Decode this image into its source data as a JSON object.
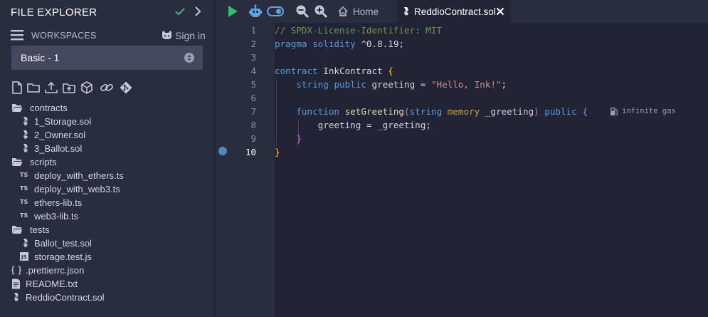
{
  "sidebar": {
    "title": "FILE EXPLORER",
    "workspaces_label": "WORKSPACES",
    "signin_label": "Sign in",
    "workspace_selected": "Basic - 1",
    "tree": [
      {
        "name": "folder-contracts",
        "label": "contracts",
        "kind": "folder"
      },
      {
        "name": "file-1-storage",
        "label": "1_Storage.sol",
        "kind": "sol"
      },
      {
        "name": "file-2-owner",
        "label": "2_Owner.sol",
        "kind": "sol"
      },
      {
        "name": "file-3-ballot",
        "label": "3_Ballot.sol",
        "kind": "sol"
      },
      {
        "name": "folder-scripts",
        "label": "scripts",
        "kind": "folder"
      },
      {
        "name": "file-deploy-ethers",
        "label": "deploy_with_ethers.ts",
        "kind": "ts"
      },
      {
        "name": "file-deploy-web3",
        "label": "deploy_with_web3.ts",
        "kind": "ts"
      },
      {
        "name": "file-ethers-lib",
        "label": "ethers-lib.ts",
        "kind": "ts"
      },
      {
        "name": "file-web3-lib",
        "label": "web3-lib.ts",
        "kind": "ts"
      },
      {
        "name": "folder-tests",
        "label": "tests",
        "kind": "folder"
      },
      {
        "name": "file-ballot-test",
        "label": "Ballot_test.sol",
        "kind": "sol"
      },
      {
        "name": "file-storage-test",
        "label": "storage.test.js",
        "kind": "js"
      },
      {
        "name": "file-prettierrc",
        "label": ".prettierrc.json",
        "kind": "json"
      },
      {
        "name": "file-readme",
        "label": "README.txt",
        "kind": "txt"
      },
      {
        "name": "file-reddio-contract",
        "label": "ReddioContract.sol",
        "kind": "sol"
      }
    ],
    "ts_badge": "TS",
    "js_badge": "JS"
  },
  "topbar": {
    "home_tab_label": "Home",
    "active_tab_label": "ReddioContract.sol"
  },
  "editor": {
    "line_numbers": [
      "1",
      "2",
      "3",
      "4",
      "5",
      "6",
      "7",
      "8",
      "9",
      "10"
    ],
    "active_line": "10",
    "lines": [
      [
        {
          "t": "// SPDX-License-Identifier: MIT",
          "c": "c-comment"
        }
      ],
      [
        {
          "t": "pragma",
          "c": "c-kw"
        },
        {
          "t": " ",
          "c": "c-text"
        },
        {
          "t": "solidity",
          "c": "c-kw"
        },
        {
          "t": " ^0.8.19;",
          "c": "c-text"
        }
      ],
      [],
      [
        {
          "t": "contract",
          "c": "c-kw"
        },
        {
          "t": " InkContract ",
          "c": "c-text"
        },
        {
          "t": "{",
          "c": "c-br1"
        }
      ],
      [
        {
          "t": "    ",
          "c": "c-text"
        },
        {
          "t": "string",
          "c": "c-type"
        },
        {
          "t": " ",
          "c": "c-text"
        },
        {
          "t": "public",
          "c": "c-kw"
        },
        {
          "t": " greeting = ",
          "c": "c-text"
        },
        {
          "t": "\"Hello, Ink!\"",
          "c": "c-str"
        },
        {
          "t": ";",
          "c": "c-text"
        }
      ],
      [],
      [
        {
          "t": "    ",
          "c": "c-text"
        },
        {
          "t": "function",
          "c": "c-kw"
        },
        {
          "t": " ",
          "c": "c-text"
        },
        {
          "t": "setGreeting",
          "c": "c-fn"
        },
        {
          "t": "(",
          "c": "c-br2"
        },
        {
          "t": "string",
          "c": "c-type"
        },
        {
          "t": " ",
          "c": "c-text"
        },
        {
          "t": "memory",
          "c": "c-mem"
        },
        {
          "t": " _greeting",
          "c": "c-text"
        },
        {
          "t": ")",
          "c": "c-br2"
        },
        {
          "t": " ",
          "c": "c-text"
        },
        {
          "t": "public",
          "c": "c-kw"
        },
        {
          "t": " ",
          "c": "c-text"
        },
        {
          "t": "{",
          "c": "c-br2"
        }
      ],
      [
        {
          "t": "        greeting = _greeting;",
          "c": "c-text"
        }
      ],
      [
        {
          "t": "    ",
          "c": "c-text"
        },
        {
          "t": "}",
          "c": "c-br2"
        }
      ],
      [
        {
          "t": "}",
          "c": "c-br1"
        }
      ]
    ],
    "gas_hint": "infinite gas"
  }
}
